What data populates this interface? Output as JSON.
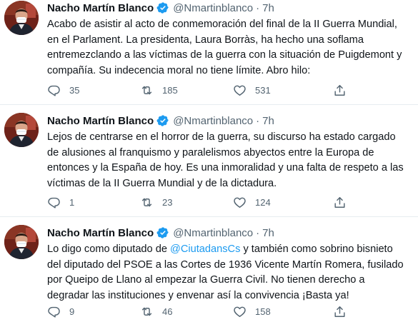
{
  "tweets": [
    {
      "name": "Nacho Martín Blanco",
      "handle": "@Nmartinblanco",
      "separator": "·",
      "time": "7h",
      "text": "Acabo de asistir al acto de conmemoración del final de la II Guerra Mundial,\nen el Parlament. La presidenta, Laura Borràs, ha hecho una soflama\nentremezclando a las víctimas de la guerra con la situación de Puigdemont y\ncompañía. Su indecencia moral no tiene límite. Abro hilo:",
      "replies": "35",
      "retweets": "185",
      "likes": "531"
    },
    {
      "name": "Nacho Martín Blanco",
      "handle": "@Nmartinblanco",
      "separator": "·",
      "time": "7h",
      "text": "Lejos de centrarse en el horror de la guerra, su discurso ha estado cargado\nde alusiones al franquismo y paralelismos abyectos entre la Europa de\nentonces y la España de hoy. Es una inmoralidad y una falta de respeto a las\nvíctimas de la II Guerra Mundial y de la dictadura.",
      "replies": "1",
      "retweets": "23",
      "likes": "124"
    },
    {
      "name": "Nacho Martín Blanco",
      "handle": "@Nmartinblanco",
      "separator": "·",
      "time": "7h",
      "text_before": "Lo digo como diputado de ",
      "mention": "@CiutadansCs",
      "text_after": " y también como sobrino bisnieto\ndel diputado del PSOE a las Cortes de 1936 Vicente Martín Romera, fusilado\npor Queipo de Llano al empezar la Guerra Civil. No tienen derecho a\ndegradar las instituciones y envenar así la convivencia ¡Basta ya!",
      "replies": "9",
      "retweets": "46",
      "likes": "158"
    }
  ],
  "colors": {
    "text": "#0f1419",
    "secondary": "#536471",
    "link": "#1d9bf0",
    "verified": "#1d9bf0",
    "divider": "#e6ecf0"
  },
  "icons": [
    "verified-badge-icon",
    "reply-icon",
    "retweet-icon",
    "like-icon",
    "share-icon"
  ]
}
